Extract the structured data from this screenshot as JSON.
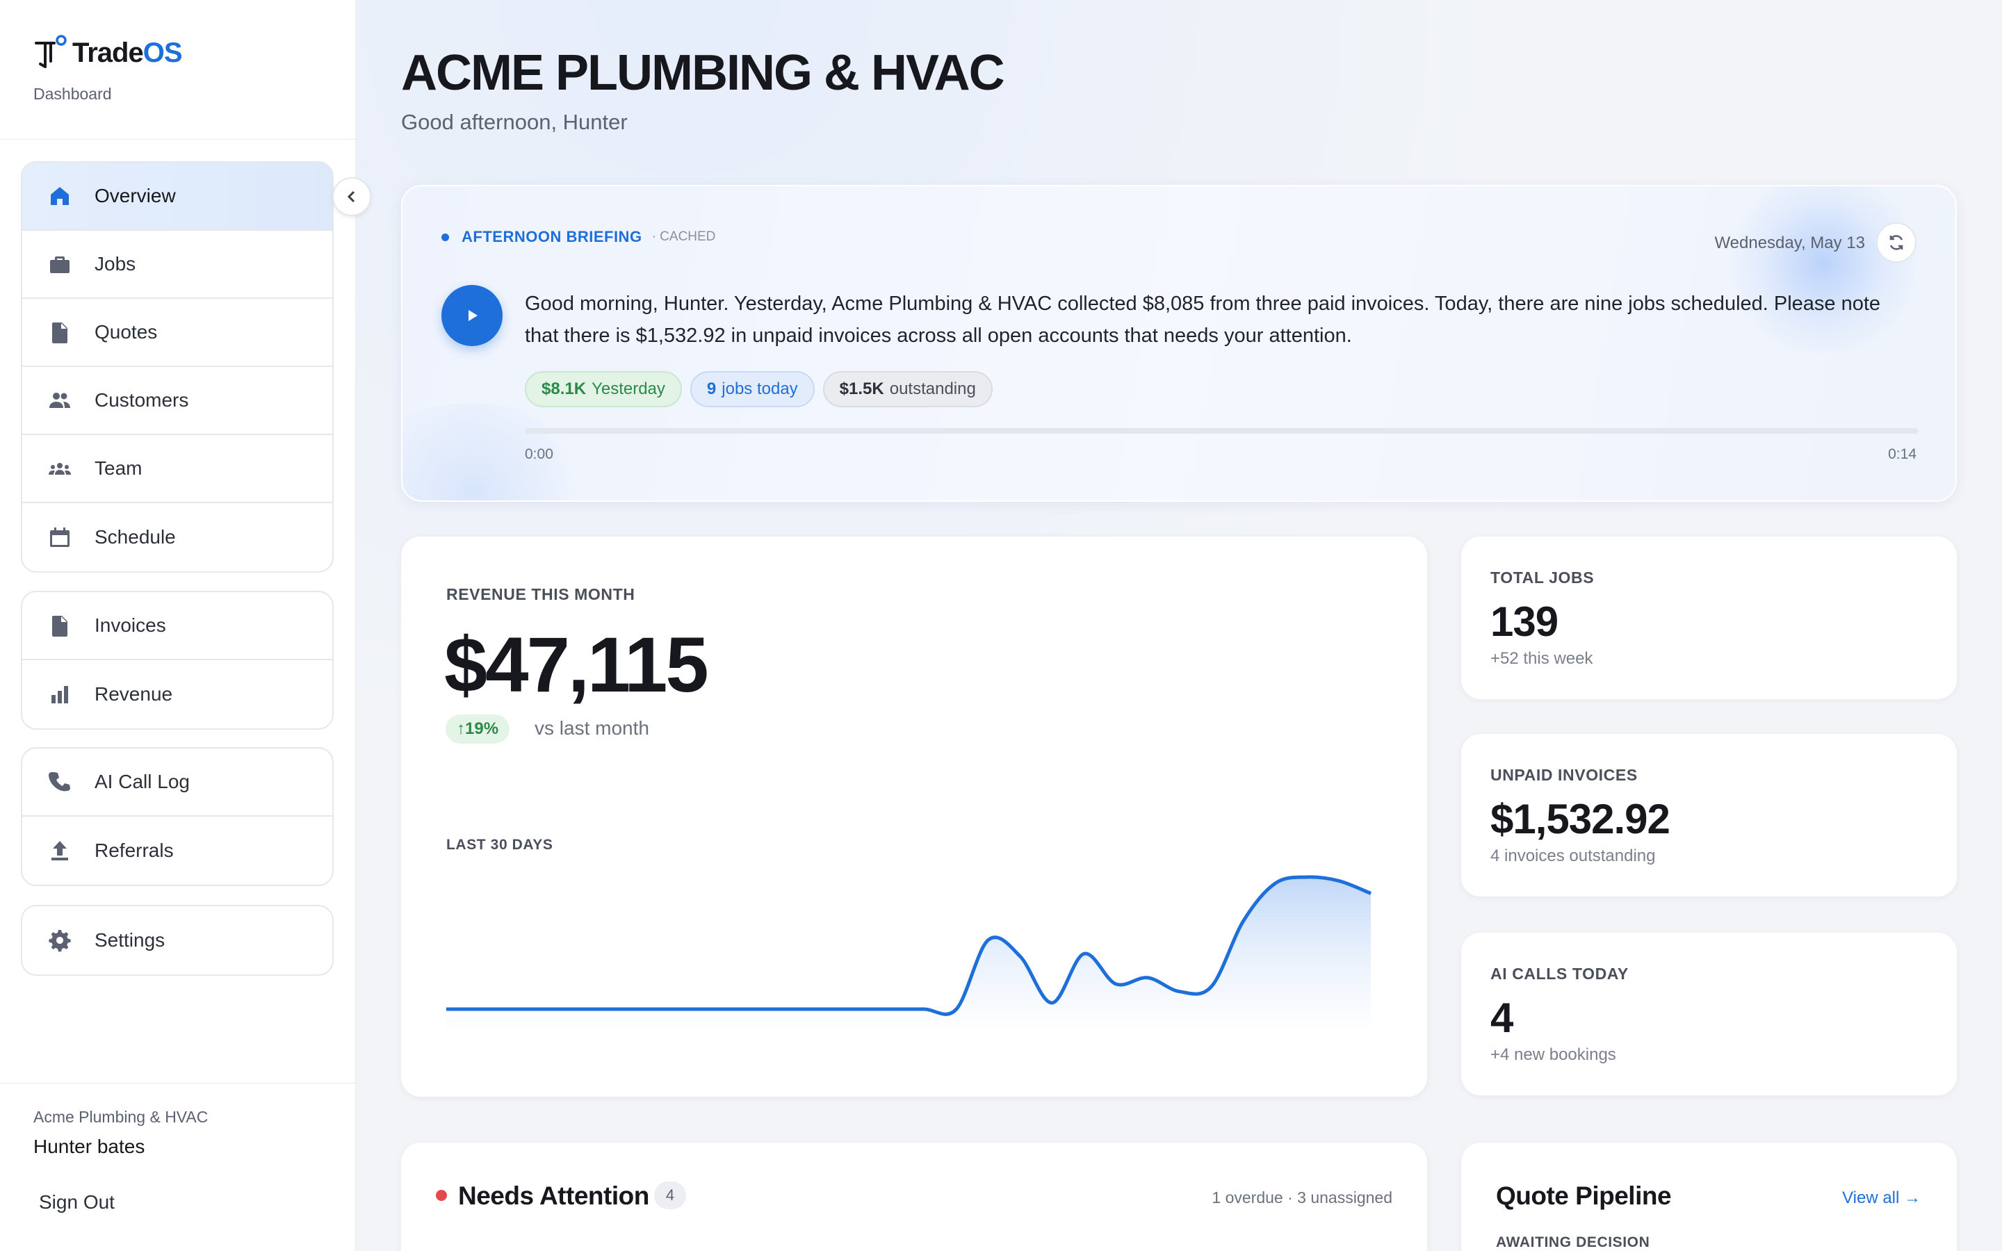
{
  "app": {
    "brand_name_part1": "Trade",
    "brand_name_part2": "OS",
    "section": "Dashboard",
    "accent_color": "#1e6fd9"
  },
  "sidebar": {
    "groups": [
      [
        {
          "label": "Overview",
          "icon": "home-icon",
          "active": true
        },
        {
          "label": "Jobs",
          "icon": "briefcase-icon"
        },
        {
          "label": "Quotes",
          "icon": "document-icon"
        },
        {
          "label": "Customers",
          "icon": "people-icon"
        },
        {
          "label": "Team",
          "icon": "group-icon"
        },
        {
          "label": "Schedule",
          "icon": "calendar-icon"
        }
      ],
      [
        {
          "label": "Invoices",
          "icon": "document-icon"
        },
        {
          "label": "Revenue",
          "icon": "bar-chart-icon"
        }
      ],
      [
        {
          "label": "AI Call Log",
          "icon": "phone-icon"
        },
        {
          "label": "Referrals",
          "icon": "upload-icon"
        }
      ],
      [
        {
          "label": "Settings",
          "icon": "gear-icon"
        }
      ]
    ],
    "org_name": "Acme Plumbing & HVAC",
    "user_name": "Hunter bates",
    "sign_out": "Sign Out"
  },
  "header": {
    "title": "ACME PLUMBING & HVAC",
    "greeting": "Good afternoon, Hunter"
  },
  "briefing": {
    "title": "AFTERNOON BRIEFING",
    "status": "· CACHED",
    "date": "Wednesday, May 13",
    "text": "Good morning, Hunter. Yesterday, Acme Plumbing & HVAC collected $8,085 from three paid invoices. Today, there are nine jobs scheduled. Please note that there is $1,532.92 in unpaid invoices across all open accounts that needs your attention.",
    "chips": [
      {
        "strong": "$8.1K",
        "text": "Yesterday",
        "color": "green"
      },
      {
        "strong": "9",
        "text": "jobs today",
        "color": "blue"
      },
      {
        "strong": "$1.5K",
        "text": "outstanding",
        "color": "gray"
      }
    ],
    "time_start": "0:00",
    "time_end": "0:14",
    "progress": 0
  },
  "revenue": {
    "label": "REVENUE THIS MONTH",
    "value": "$47,115",
    "change": "↑19%",
    "change_suffix": "vs last month",
    "period_label": "LAST 30 DAYS"
  },
  "chart_data": {
    "type": "area",
    "title": "",
    "x": [
      1,
      2,
      3,
      4,
      5,
      6,
      7,
      8,
      9,
      10,
      11,
      12,
      13,
      14,
      15,
      16,
      17,
      18,
      19,
      20,
      21,
      22,
      23,
      24,
      25,
      26,
      27,
      28,
      29,
      30
    ],
    "values": [
      0,
      0,
      0,
      0,
      0,
      0,
      0,
      0,
      0,
      0,
      0,
      0,
      0,
      0,
      0,
      0,
      0,
      0.55,
      0.42,
      0.05,
      0.44,
      0.2,
      0.25,
      0.14,
      0.18,
      0.7,
      1.0,
      1.05,
      1.02,
      0.92
    ],
    "xlabel": "",
    "ylabel": "",
    "grid": false,
    "color": "#1e6fd9"
  },
  "stats": [
    {
      "label": "TOTAL JOBS",
      "value": "139",
      "sub": "+52 this week"
    },
    {
      "label": "UNPAID INVOICES",
      "value": "$1,532.92",
      "sub": "4 invoices outstanding"
    },
    {
      "label": "AI CALLS TODAY",
      "value": "4",
      "sub": "+4 new bookings"
    }
  ],
  "attention": {
    "title": "Needs Attention",
    "count": "4",
    "meta": "1 overdue · 3 unassigned"
  },
  "pipeline": {
    "title": "Quote Pipeline",
    "link": "View all →",
    "subheading": "AWAITING DECISION"
  }
}
